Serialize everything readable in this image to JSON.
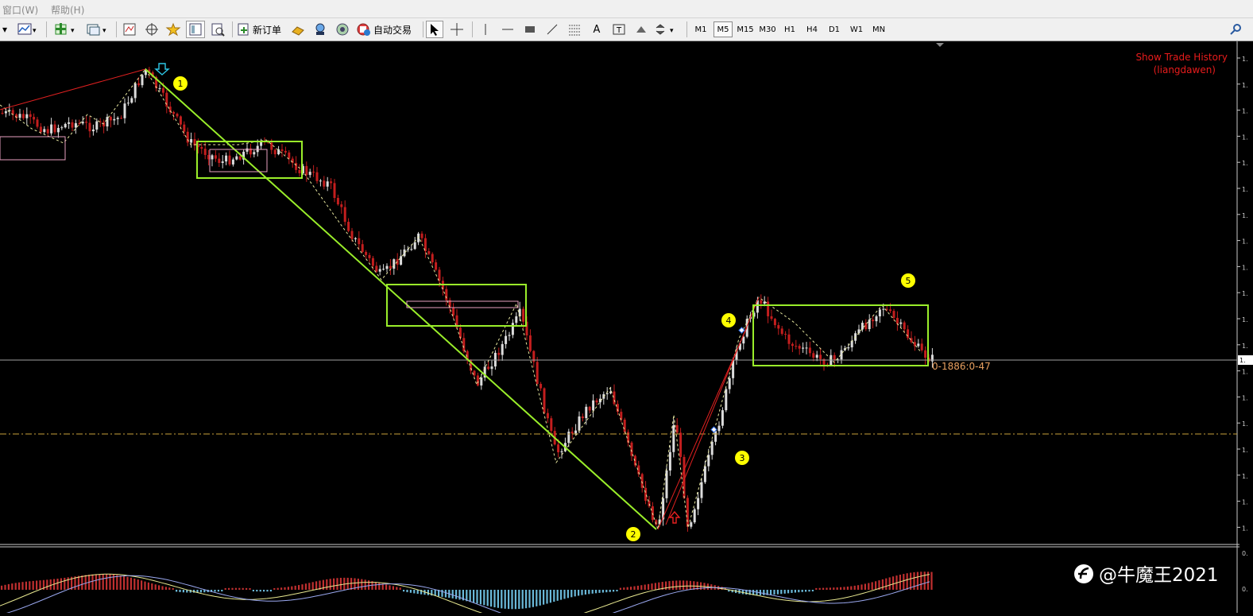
{
  "menu": {
    "window": "窗口(W)",
    "help": "帮助(H)"
  },
  "toolbar": {
    "new_order": "新订单",
    "auto_trade": "自动交易",
    "timeframes": [
      "M1",
      "M5",
      "M15",
      "M30",
      "H1",
      "H4",
      "D1",
      "W1",
      "MN"
    ],
    "active_timeframe": "M5"
  },
  "chart": {
    "indicator_title": "Show Trade History",
    "indicator_author": "(liangdawen)",
    "trade_label": "0-1886:0-47",
    "wave_labels": [
      "1",
      "2",
      "3",
      "4",
      "5"
    ],
    "watermark": "@牛魔王2021",
    "price_axis_ticks": [
      "1.",
      "1.",
      "1.",
      "1.",
      "1.",
      "1.",
      "1.",
      "1.",
      "1.",
      "1.",
      "1.",
      "1.",
      "1.",
      "1.",
      "1.",
      "1.",
      "1.",
      "1.",
      "1.",
      "1."
    ],
    "current_price_tag": "1.",
    "indicator_axis_ticks": [
      "0.",
      "0."
    ]
  },
  "colors": {
    "background": "#000000",
    "bull_candle": "#dcdcdc",
    "bear_candle": "#c41e1e",
    "green_lines": "#9aee2a",
    "red_lines": "#e02020",
    "wave_marker": "#ffff00",
    "trade_label": "#e8a060"
  }
}
